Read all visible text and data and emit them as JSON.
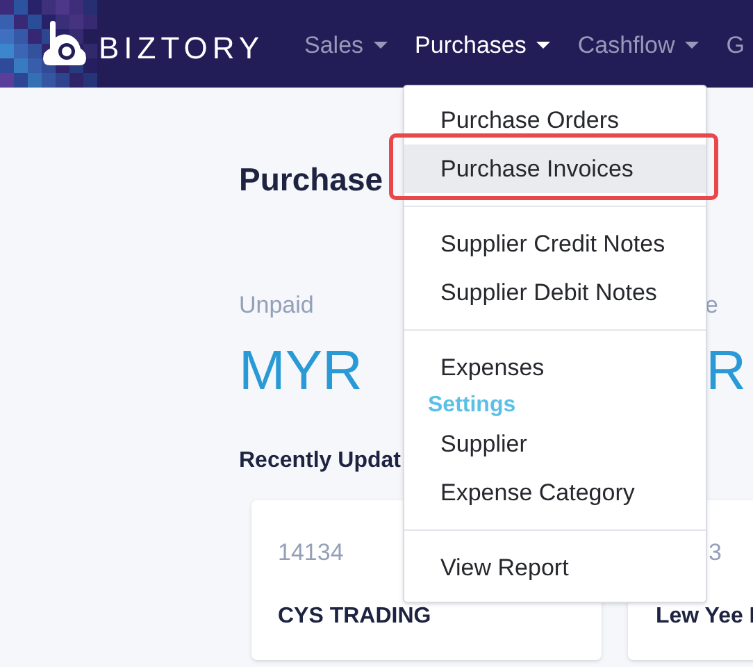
{
  "navbar": {
    "brand": "BIZTORY",
    "items": [
      {
        "label": "Sales",
        "selected": false,
        "has_caret": true
      },
      {
        "label": "Purchases",
        "selected": true,
        "has_caret": true
      },
      {
        "label": "Cashflow",
        "selected": false,
        "has_caret": true
      },
      {
        "label": "G",
        "selected": false,
        "has_caret": false
      }
    ]
  },
  "page": {
    "title": "Purchase",
    "summary": [
      {
        "label": "Unpaid",
        "amount": "MYR"
      },
      {
        "label": "e",
        "amount": "R"
      }
    ],
    "recent_heading": "Recently Updat",
    "cards": [
      {
        "number": "14134",
        "name": "CYS TRADING"
      },
      {
        "number": "3",
        "name": "Lew Yee I"
      }
    ]
  },
  "dropdown": {
    "items": [
      {
        "kind": "item",
        "label": "Purchase Orders",
        "selected": false,
        "outlined": false
      },
      {
        "kind": "item",
        "label": "Purchase Invoices",
        "selected": true,
        "outlined": true
      },
      {
        "kind": "divider"
      },
      {
        "kind": "item",
        "label": "Supplier Credit Notes",
        "selected": false,
        "outlined": false
      },
      {
        "kind": "item",
        "label": "Supplier Debit Notes",
        "selected": false,
        "outlined": false
      },
      {
        "kind": "divider"
      },
      {
        "kind": "item",
        "label": "Expenses",
        "selected": false,
        "outlined": false
      },
      {
        "kind": "header",
        "label": "Settings"
      },
      {
        "kind": "item",
        "label": "Supplier",
        "selected": false,
        "outlined": false
      },
      {
        "kind": "item",
        "label": "Expense Category",
        "selected": false,
        "outlined": false
      },
      {
        "kind": "divider"
      },
      {
        "kind": "item",
        "label": "View Report",
        "selected": false,
        "outlined": false
      }
    ]
  }
}
